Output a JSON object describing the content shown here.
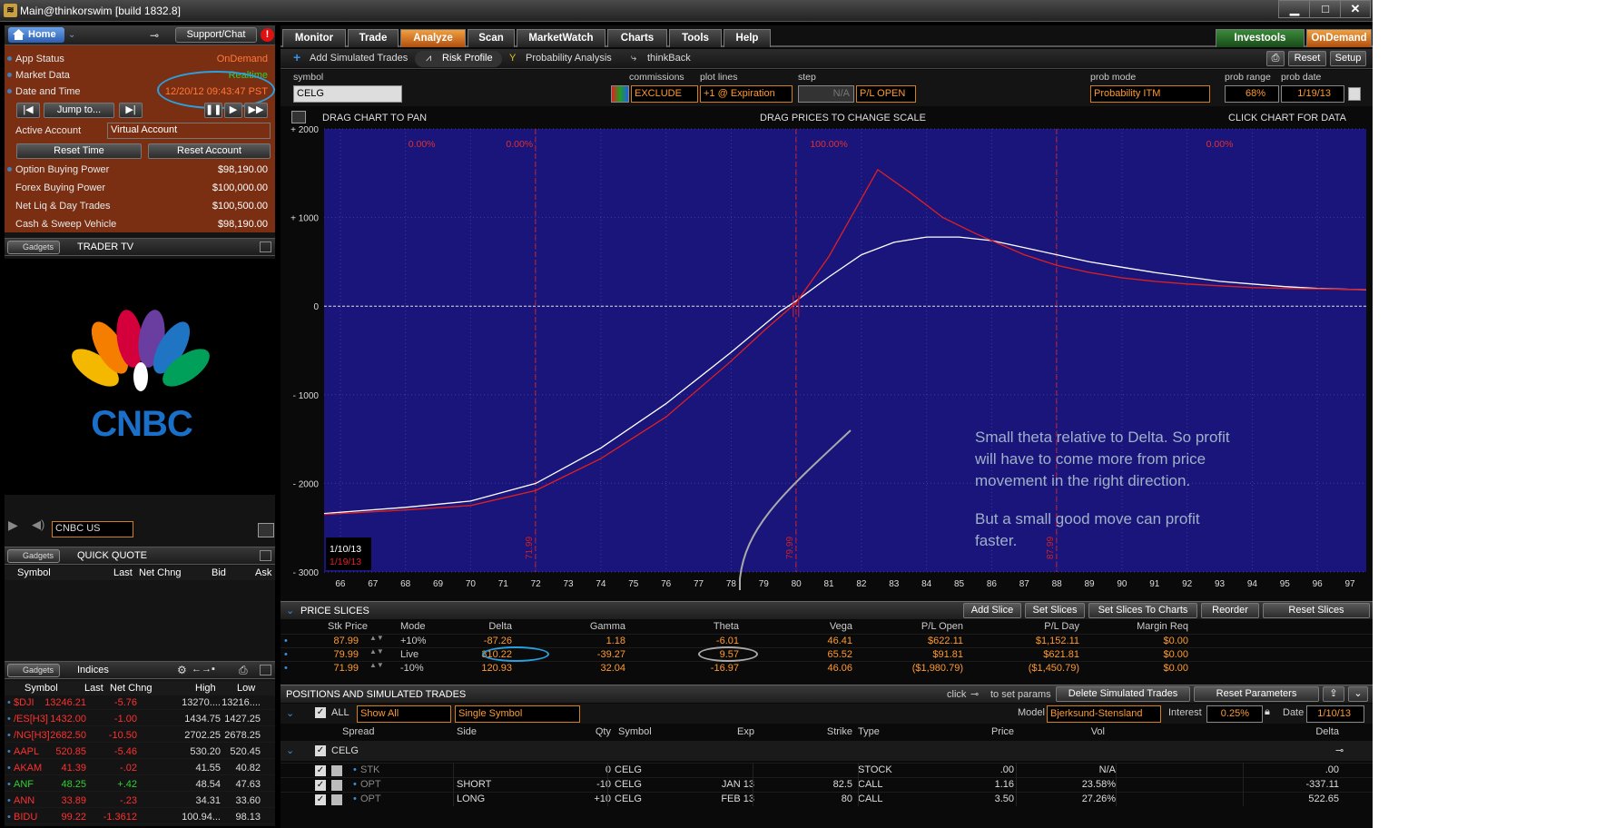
{
  "window": {
    "title": "Main@thinkorswim [build 1832.8]",
    "min": "▁",
    "max": "□",
    "close": "✕"
  },
  "left": {
    "home": "Home",
    "support": "Support/Chat",
    "alert": "!",
    "account_rows": [
      {
        "k": "App Status",
        "v": "OnDemand"
      },
      {
        "k": "Market Data",
        "v": "Realtime"
      },
      {
        "k": "Date and Time",
        "v": "12/20/12 09:43:47 PST"
      }
    ],
    "jump_to": "Jump to...",
    "active_account_label": "Active Account",
    "active_account_value": "Virtual Account",
    "reset_time": "Reset Time",
    "reset_account": "Reset Account",
    "balances": [
      {
        "k": "Option Buying Power",
        "v": "$98,190.00"
      },
      {
        "k": "Forex Buying Power",
        "v": "$100,000.00"
      },
      {
        "k": "Net Liq & Day Trades",
        "v": "$100,500.00"
      },
      {
        "k": "Cash & Sweep Vehicle",
        "v": "$98,190.00"
      }
    ],
    "gadgets": "Gadgets",
    "trader_tv": "TRADER TV",
    "cnbc_text": "CNBC",
    "channel": "CNBC US",
    "quick_quote": "QUICK QUOTE",
    "qq_headers": {
      "symbol": "Symbol",
      "last": "Last",
      "net": "Net Chng",
      "bid": "Bid",
      "ask": "Ask"
    },
    "indices": "Indices",
    "idx_headers": {
      "symbol": "Symbol",
      "last": "Last",
      "net": "Net Chng",
      "high": "High",
      "low": "Low"
    },
    "idx_rows": [
      {
        "s": "$DJI",
        "l": "13246.21",
        "n": "-5.76",
        "h": "13270....",
        "lo": "13216...."
      },
      {
        "s": "/ES[H3]",
        "l": "1432.00",
        "n": "-1.00",
        "h": "1434.75",
        "lo": "1427.25"
      },
      {
        "s": "/NG[H3]",
        "l": "2682.50",
        "n": "-10.50",
        "h": "2702.25",
        "lo": "2678.25"
      },
      {
        "s": "AAPL",
        "l": "520.85",
        "n": "-5.46",
        "h": "530.20",
        "lo": "520.45"
      },
      {
        "s": "AKAM",
        "l": "41.39",
        "n": "-.02",
        "h": "41.55",
        "lo": "40.82"
      },
      {
        "s": "ANF",
        "l": "48.25",
        "n": "+.42",
        "h": "48.54",
        "lo": "47.63"
      },
      {
        "s": "ANN",
        "l": "33.89",
        "n": "-.23",
        "h": "34.31",
        "lo": "33.60"
      },
      {
        "s": "BIDU",
        "l": "99.22",
        "n": "-1.3612",
        "h": "100.94...",
        "lo": "98.13"
      }
    ]
  },
  "tabs": [
    "Monitor",
    "Trade",
    "Analyze",
    "Scan",
    "MarketWatch",
    "Charts",
    "Tools",
    "Help"
  ],
  "investools": "Investools",
  "ondemand": "OnDemand",
  "subtabs": [
    "Add Simulated Trades",
    "Risk Profile",
    "Probability Analysis",
    "thinkBack"
  ],
  "reset": "Reset",
  "setup": "Setup",
  "controls": {
    "symbol_label": "symbol",
    "symbol": "CELG",
    "commissions_label": "commissions",
    "commissions": "EXCLUDE",
    "plot_lines_label": "plot lines",
    "plot_lines": "+1 @ Expiration",
    "step_label": "step",
    "step": "N/A",
    "pl_open": "P/L OPEN",
    "prob_mode_label": "prob mode",
    "prob_mode": "Probability ITM",
    "prob_range_label": "prob range",
    "prob_range": "68%",
    "prob_date_label": "prob date",
    "prob_date": "1/19/13"
  },
  "chart_hints": {
    "pan": "DRAG CHART TO PAN",
    "scale": "DRAG PRICES TO CHANGE SCALE",
    "data": "CLICK CHART FOR DATA"
  },
  "chart_data": {
    "type": "line",
    "ylim": [
      -3000,
      2000
    ],
    "xlim": [
      65.5,
      97.5
    ],
    "y_ticks": [
      "+ 2000",
      "+ 1000",
      "0",
      "- 1000",
      "- 2000",
      "- 3000"
    ],
    "y_tick_values": [
      2000,
      1000,
      0,
      -1000,
      -2000,
      -3000
    ],
    "x_ticks": [
      66,
      67,
      68,
      69,
      70,
      71,
      72,
      73,
      74,
      75,
      76,
      77,
      78,
      79,
      80,
      81,
      82,
      83,
      84,
      85,
      86,
      87,
      88,
      89,
      90,
      91,
      92,
      93,
      94,
      95,
      96,
      97
    ],
    "prob_regions": [
      "0.00%",
      "0.00%",
      "100.00%",
      "0.00%"
    ],
    "prob_region_x": [
      68.5,
      71.5,
      81,
      93
    ],
    "vlines": [
      {
        "x": 71.99,
        "label": "71.99"
      },
      {
        "x": 79.99,
        "label": "79.99"
      },
      {
        "x": 87.99,
        "label": "87.99"
      }
    ],
    "legend_dates": [
      "1/10/13",
      "1/19/13"
    ],
    "series": [
      {
        "name": "1/10/13",
        "color": "#ffffff",
        "points": [
          [
            65.5,
            -2340
          ],
          [
            68,
            -2270
          ],
          [
            70,
            -2200
          ],
          [
            72,
            -2000
          ],
          [
            74,
            -1600
          ],
          [
            76,
            -1100
          ],
          [
            78,
            -520
          ],
          [
            79.5,
            -60
          ],
          [
            80,
            60
          ],
          [
            81,
            330
          ],
          [
            82,
            580
          ],
          [
            83,
            720
          ],
          [
            84,
            780
          ],
          [
            85,
            780
          ],
          [
            86,
            740
          ],
          [
            87,
            660
          ],
          [
            88,
            580
          ],
          [
            89,
            500
          ],
          [
            90,
            440
          ],
          [
            91,
            380
          ],
          [
            92,
            330
          ],
          [
            93,
            280
          ],
          [
            94,
            250
          ],
          [
            95,
            220
          ],
          [
            96,
            200
          ],
          [
            97,
            190
          ],
          [
            97.5,
            185
          ]
        ]
      },
      {
        "name": "1/19/13",
        "color": "#e02020",
        "points": [
          [
            65.5,
            -2350
          ],
          [
            68,
            -2300
          ],
          [
            70,
            -2250
          ],
          [
            72,
            -2080
          ],
          [
            74,
            -1720
          ],
          [
            76,
            -1250
          ],
          [
            78,
            -620
          ],
          [
            79,
            -280
          ],
          [
            80,
            40
          ],
          [
            81,
            560
          ],
          [
            82.5,
            1540
          ],
          [
            83.5,
            1280
          ],
          [
            84.5,
            1000
          ],
          [
            85.5,
            820
          ],
          [
            87,
            580
          ],
          [
            88,
            460
          ],
          [
            89,
            380
          ],
          [
            90,
            320
          ],
          [
            91,
            280
          ],
          [
            92,
            250
          ],
          [
            93,
            230
          ],
          [
            94,
            210
          ],
          [
            95,
            200
          ],
          [
            96,
            195
          ],
          [
            97,
            190
          ],
          [
            97.5,
            188
          ]
        ]
      }
    ]
  },
  "annotation": {
    "line1": "Small theta relative to Delta. So profit",
    "line2": "will have to come more from price",
    "line3": "movement in the right direction.",
    "line4": "But a small good move can profit",
    "line5": "faster."
  },
  "slices": {
    "title": "PRICE SLICES",
    "buttons": [
      "Add Slice",
      "Set Slices",
      "Set Slices To Charts",
      "Reorder",
      "Reset Slices"
    ],
    "headers": [
      "Stk Price",
      "Mode",
      "Delta",
      "Gamma",
      "Theta",
      "Vega",
      "P/L Open",
      "P/L Day",
      "Margin Req"
    ],
    "rows": [
      [
        "87.99",
        "+10%",
        "-87.26",
        "1.18",
        "-6.01",
        "46.41",
        "$622.11",
        "$1,152.11",
        "$0.00"
      ],
      [
        "79.99",
        "Live",
        "310.22",
        "-39.27",
        "9.57",
        "65.52",
        "$91.81",
        "$621.81",
        "$0.00"
      ],
      [
        "71.99",
        "-10%",
        "120.93",
        "32.04",
        "-16.97",
        "46.06",
        "($1,980.79)",
        "($1,450.79)",
        "$0.00"
      ]
    ]
  },
  "positions": {
    "title": "POSITIONS AND SIMULATED TRADES",
    "click": "click",
    "set_params": "to set params",
    "delete_btn": "Delete Simulated Trades",
    "reset_params": "Reset Parameters",
    "all": "ALL",
    "show": "Show All",
    "single": "Single Symbol",
    "model_label": "Model",
    "model": "Bjerksund-Stensland",
    "interest_label": "Interest",
    "interest": "0.25%",
    "date_label": "Date",
    "date": "1/10/13",
    "headers": [
      "Spread",
      "Side",
      "Qty",
      "Symbol",
      "Exp",
      "Strike",
      "Type",
      "Price",
      "Vol",
      "Delta"
    ],
    "group": "CELG",
    "rows": [
      {
        "spread": "STK",
        "side": "",
        "qty": "0",
        "sym": "CELG",
        "exp": "",
        "strike": "",
        "type": "STOCK",
        "price": ".00",
        "vol": "N/A",
        "delta": ".00"
      },
      {
        "spread": "OPT",
        "side": "SHORT",
        "qty": "-10",
        "sym": "CELG",
        "exp": "JAN 13",
        "strike": "82.5",
        "type": "CALL",
        "price": "1.16",
        "vol": "23.58%",
        "delta": "-337.11"
      },
      {
        "spread": "OPT",
        "side": "LONG",
        "qty": "+10",
        "sym": "CELG",
        "exp": "FEB 13",
        "strike": "80",
        "type": "CALL",
        "price": "3.50",
        "vol": "27.26%",
        "delta": "522.65"
      }
    ]
  }
}
